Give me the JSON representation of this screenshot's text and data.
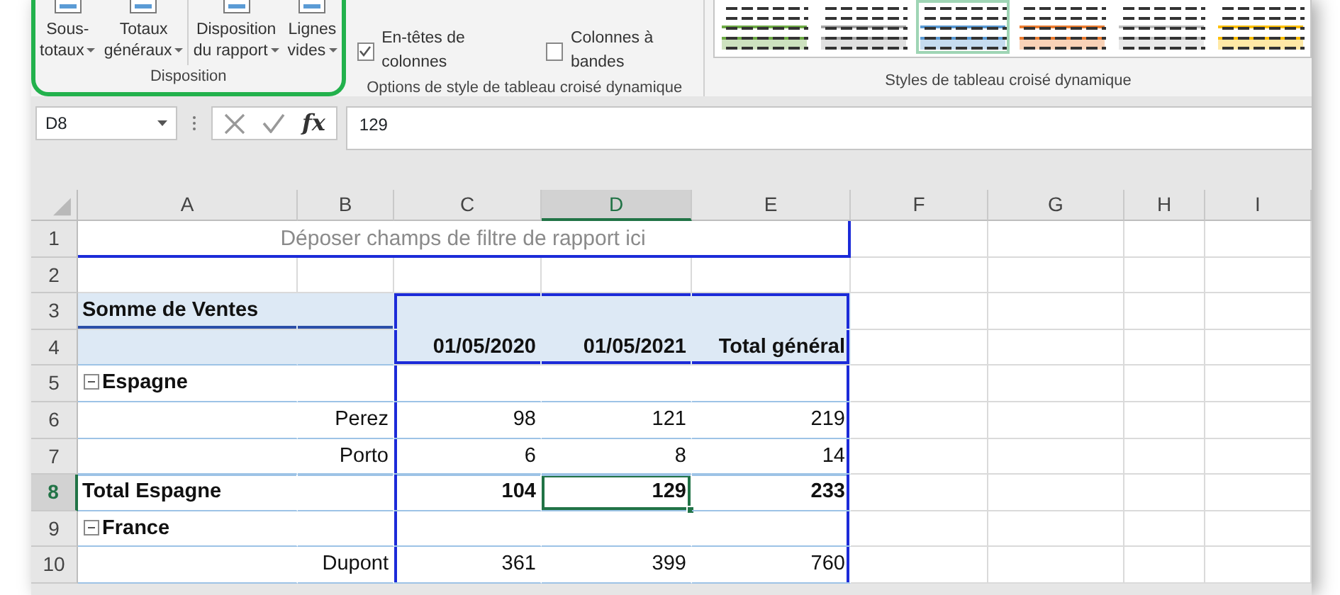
{
  "ribbon": {
    "groups": [
      {
        "kind": "buttons",
        "label": "Disposition",
        "highlighted": true,
        "buttons": [
          {
            "lines": [
              "Sous-",
              "totaux"
            ],
            "dropdown": true
          },
          {
            "lines": [
              "Totaux",
              "généraux"
            ],
            "dropdown": true
          },
          {
            "lines": [
              "Disposition",
              "du rapport"
            ],
            "dropdown": true
          },
          {
            "lines": [
              "Lignes",
              "vides"
            ],
            "dropdown": true
          }
        ]
      },
      {
        "kind": "checkboxes",
        "label": "Options de style de tableau croisé dynamique",
        "checkboxes": [
          {
            "label": "En-têtes de colonnes",
            "checked": true
          },
          {
            "label": "Colonnes à bandes",
            "checked": false
          }
        ]
      },
      {
        "kind": "gallery",
        "label": "Styles de tableau croisé dynamique",
        "styles": [
          {
            "color": "#70ad47",
            "selected": false
          },
          {
            "color": "#a5a5a5",
            "selected": false
          },
          {
            "color": "#5b9bd5",
            "selected": true
          },
          {
            "color": "#ed7d31",
            "selected": false
          },
          {
            "color": "#bfbfbf",
            "selected": false
          },
          {
            "color": "#ffc000",
            "selected": false
          }
        ]
      }
    ]
  },
  "formula_bar": {
    "name_box": "D8",
    "function_button": "fx",
    "formula": "129"
  },
  "columns": [
    {
      "label": "A",
      "selected": false
    },
    {
      "label": "B",
      "selected": false
    },
    {
      "label": "C",
      "selected": false
    },
    {
      "label": "D",
      "selected": true
    },
    {
      "label": "E",
      "selected": false
    },
    {
      "label": "F",
      "selected": false
    },
    {
      "label": "G",
      "selected": false
    },
    {
      "label": "H",
      "selected": false
    },
    {
      "label": "I",
      "selected": false
    }
  ],
  "rows": [
    {
      "number": "1",
      "selected": false,
      "kind": "filter_zone",
      "label": "Déposer champs de filtre de rapport ici"
    },
    {
      "number": "2",
      "selected": false,
      "kind": "blank"
    },
    {
      "number": "3",
      "selected": false,
      "kind": "values_header",
      "label": "Somme de Ventes"
    },
    {
      "number": "4",
      "selected": false,
      "kind": "column_labels",
      "values": [
        "01/05/2020",
        "01/05/2021",
        "Total général"
      ]
    },
    {
      "number": "5",
      "selected": false,
      "kind": "group",
      "label": "Espagne",
      "expanded": true
    },
    {
      "number": "6",
      "selected": false,
      "kind": "item",
      "label": "Perez",
      "values": [
        "98",
        "121",
        "219"
      ]
    },
    {
      "number": "7",
      "selected": false,
      "kind": "item",
      "label": "Porto",
      "values": [
        "6",
        "8",
        "14"
      ]
    },
    {
      "number": "8",
      "selected": true,
      "kind": "subtotal",
      "label": "Total Espagne",
      "values": [
        "104",
        "129",
        "233"
      ]
    },
    {
      "number": "9",
      "selected": false,
      "kind": "group",
      "label": "France",
      "expanded": true
    },
    {
      "number": "10",
      "selected": false,
      "kind": "item",
      "label": "Dupont",
      "values": [
        "361",
        "399",
        "760"
      ]
    }
  ]
}
